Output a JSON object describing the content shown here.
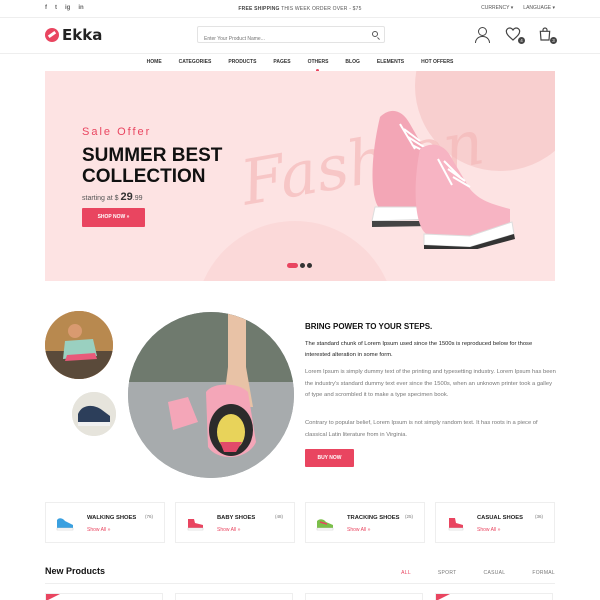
{
  "topbar": {
    "social": [
      "f",
      "t",
      "ig",
      "in"
    ],
    "promo_bold": "FREE SHIPPING",
    "promo_rest": "THIS WEEK ORDER OVER - $75",
    "currency": "CURRENCY",
    "language": "LANGUAGE"
  },
  "header": {
    "logo": "Ekka",
    "search_placeholder": "Enter Your Product Name...",
    "wishlist_count": "4",
    "cart_count": "3"
  },
  "nav": {
    "items": [
      "HOME",
      "CATEGORIES",
      "PRODUCTS",
      "PAGES",
      "OTHERS",
      "BLOG",
      "ELEMENTS",
      "HOT OFFERS"
    ],
    "active": "OTHERS"
  },
  "hero": {
    "sale": "Sale Offer",
    "title": "SUMMER BEST COLLECTION",
    "script": "Fashion",
    "starting": "starting at $",
    "price_int": "29",
    "price_dec": ".99",
    "cta": "SHOP NOW",
    "slides": 3,
    "active_slide": 1
  },
  "about": {
    "title": "BRING POWER TO YOUR STEPS.",
    "p1": "The standard chunk of Lorem Ipsum used since the 1500s is reproduced below for those interested alteration in some form.",
    "p2": "Lorem Ipsum is simply dummy text of the printing and typesetting industry. Lorem Ipsum has been the industry's standard dummy text ever since the 1500s, when an unknown printer took a galley of type and scrombled it to make a type specimen book.",
    "p3": "Contrary to popular belief, Lorem Ipsum is not simply random text. It has roots in a piece of classical Latin literature from in Virginia.",
    "cta": "BUY NOW"
  },
  "categories": [
    {
      "name": "WALKING SHOES",
      "count": "(76)",
      "link": "Show All",
      "color": "#3aa0e0"
    },
    {
      "name": "BABY SHOES",
      "count": "(48)",
      "link": "Show All",
      "color": "#e94560"
    },
    {
      "name": "TRACKING SHOES",
      "count": "(25)",
      "link": "Show All",
      "color": "#7bbf4a"
    },
    {
      "name": "CASUAL SHOES",
      "count": "(36)",
      "link": "Show All",
      "color": "#e94560"
    }
  ],
  "new_products": {
    "title": "New Products",
    "tabs": [
      "ALL",
      "SPORT",
      "CASUAL",
      "FORMAL"
    ],
    "active_tab": "ALL"
  },
  "colors": {
    "accent": "#e94560",
    "hero_bg": "#fde3e3"
  }
}
